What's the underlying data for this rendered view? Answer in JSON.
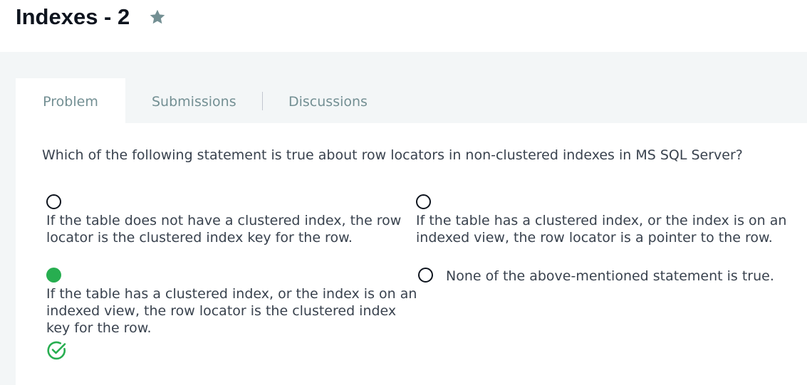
{
  "header": {
    "title": "Indexes - 2",
    "star_icon": "star-icon"
  },
  "tabs": [
    {
      "label": "Problem",
      "active": true
    },
    {
      "label": "Submissions",
      "active": false
    },
    {
      "label": "Discussions",
      "active": false
    }
  ],
  "question": "Which of the following statement is true about row locators in non-clustered indexes in MS SQL Server?",
  "options": [
    {
      "text": "If the table does not have a clustered index, the row locator is the clustered index key for the row.",
      "selected": false
    },
    {
      "text": "If the table has a clustered index, or the index is on an indexed view, the row locator is a pointer to the row.",
      "selected": false
    },
    {
      "text": "If the table has a clustered index, or the index is on an indexed view, the row locator is the clustered index key for the row.",
      "selected": true,
      "correct": true
    },
    {
      "text": "None of the above-mentioned statement is true.",
      "selected": false
    }
  ],
  "colors": {
    "accent_green": "#27ae50",
    "tab_text": "#738f93",
    "background_band": "#f3f6f7"
  }
}
